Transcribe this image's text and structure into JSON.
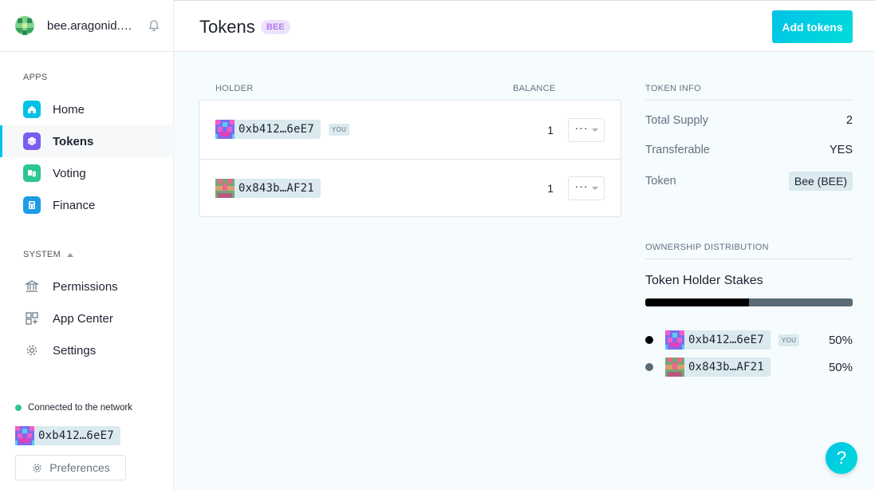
{
  "org": {
    "name": "bee.aragonid.eth"
  },
  "sidebar": {
    "apps_label": "APPS",
    "apps": [
      {
        "label": "Home",
        "icon": "home-icon",
        "color": "#00c2e8"
      },
      {
        "label": "Tokens",
        "icon": "tokens-icon",
        "color": "#7b5cf0",
        "active": true
      },
      {
        "label": "Voting",
        "icon": "voting-icon",
        "color": "#2cc68f"
      },
      {
        "label": "Finance",
        "icon": "finance-icon",
        "color": "#1c9ce5"
      }
    ],
    "system_label": "SYSTEM",
    "system": [
      {
        "label": "Permissions",
        "icon": "bank-icon"
      },
      {
        "label": "App Center",
        "icon": "grid-plus-icon"
      },
      {
        "label": "Settings",
        "icon": "gear-icon"
      }
    ],
    "connection": "Connected to the network",
    "account": "0xb412…6eE7",
    "preferences": "Preferences"
  },
  "header": {
    "title": "Tokens",
    "badge": "BEE",
    "add_button": "Add tokens"
  },
  "holders": {
    "columns": {
      "holder": "HOLDER",
      "balance": "BALANCE"
    },
    "rows": [
      {
        "address": "0xb412…6eE7",
        "you": "YOU",
        "balance": "1"
      },
      {
        "address": "0x843b…AF21",
        "balance": "1"
      }
    ]
  },
  "token_info": {
    "heading": "TOKEN INFO",
    "total_supply_label": "Total Supply",
    "total_supply": "2",
    "transferable_label": "Transferable",
    "transferable": "YES",
    "token_label": "Token",
    "token": "Bee (BEE)"
  },
  "ownership": {
    "heading": "OWNERSHIP DISTRIBUTION",
    "title": "Token Holder Stakes",
    "stakes": [
      {
        "address": "0xb412…6eE7",
        "you": "YOU",
        "percent": "50%",
        "fraction": 0.5,
        "color": "#000000"
      },
      {
        "address": "0x843b…AF21",
        "percent": "50%",
        "fraction": 0.5,
        "color": "#5a6b75"
      }
    ]
  },
  "help_label": "?"
}
